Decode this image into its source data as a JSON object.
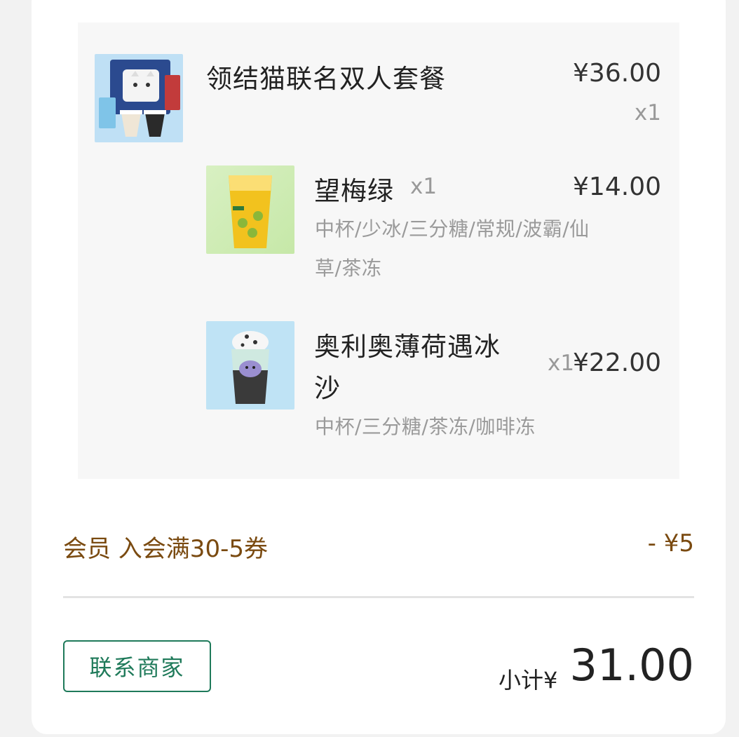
{
  "order": {
    "bundle": {
      "name": "领结猫联名双人套餐",
      "price": "¥36.00",
      "qty": "x1",
      "image_icon": "bundle-product-image"
    },
    "items": [
      {
        "name": "望梅绿",
        "qty": "x1",
        "price": "¥14.00",
        "spec_line1": "中杯/少冰/三分糖/常规/波霸/仙",
        "spec_line2": "草/茶冻",
        "image_icon": "plum-green-tea-image"
      },
      {
        "name_line1": "奥利奥薄荷遇冰",
        "name_line2": "沙",
        "qty": "x1",
        "price": "¥22.00",
        "spec": "中杯/三分糖/茶冻/咖啡冻",
        "image_icon": "oreo-mint-smoothie-image"
      }
    ]
  },
  "promotion": {
    "label": "会员 入会满30-5券",
    "amount": "- ¥5"
  },
  "footer": {
    "contact_button": "联系商家",
    "subtotal_label": "小计¥",
    "subtotal_value": "31.00"
  },
  "colors": {
    "accent_green": "#1f7a5a",
    "promo_brown": "#7a4a10"
  }
}
